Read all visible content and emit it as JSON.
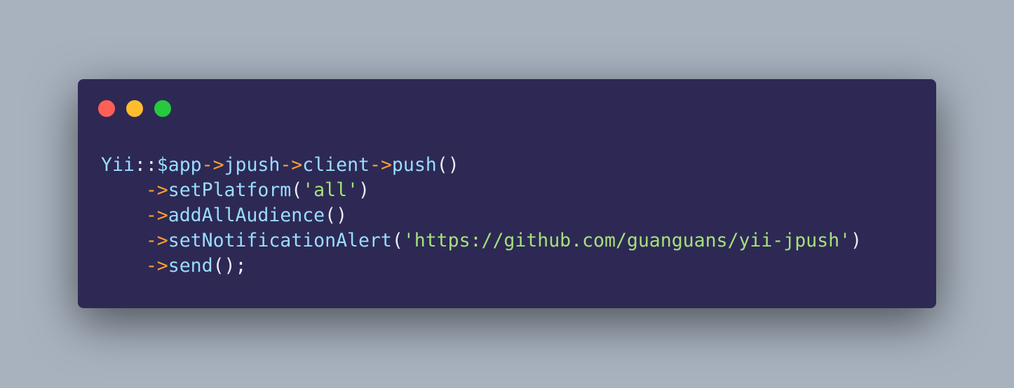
{
  "colors": {
    "background": "#a8b2bf",
    "window": "#2d2954",
    "identifier": "#9bdcff",
    "operator": "#ff9f2e",
    "string": "#a6e07c",
    "punctuation": "#e7ecf5"
  },
  "window_controls": [
    "close",
    "minimize",
    "maximize"
  ],
  "code": {
    "line1": {
      "yii": "Yii",
      "dcolon": "::",
      "app": "$app",
      "arrow1": "->",
      "jpush": "jpush",
      "arrow2": "->",
      "client": "client",
      "arrow3": "->",
      "push": "push",
      "parens": "()"
    },
    "line2": {
      "indent": "    ",
      "arrow": "->",
      "method": "setPlatform",
      "open": "(",
      "arg": "'all'",
      "close": ")"
    },
    "line3": {
      "indent": "    ",
      "arrow": "->",
      "method": "addAllAudience",
      "parens": "()"
    },
    "line4": {
      "indent": "    ",
      "arrow": "->",
      "method": "setNotificationAlert",
      "open": "(",
      "arg": "'https://github.com/guanguans/yii-jpush'",
      "close": ")"
    },
    "line5": {
      "indent": "    ",
      "arrow": "->",
      "method": "send",
      "parens": "();"
    }
  }
}
